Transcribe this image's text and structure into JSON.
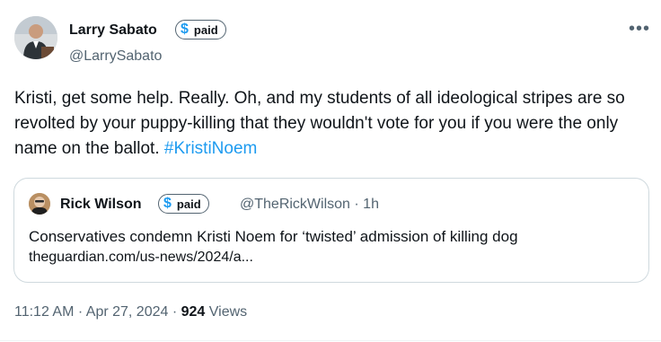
{
  "tweet": {
    "author_name": "Larry Sabato",
    "author_badge": "paid",
    "author_handle": "@LarrySabato",
    "more_icon": "more-options-icon",
    "text_main": "Kristi, get some help. Really. Oh, and my students of all ideological stripes are so revolted by your puppy-killing that they wouldn't vote for you if you were the only name on the ballot. ",
    "hashtag": "#KristiNoem",
    "timestamp": "11:12 AM",
    "separator": "·",
    "date": "Apr 27, 2024",
    "views_count": "924",
    "views_label": "Views"
  },
  "quote": {
    "author_name": "Rick Wilson",
    "author_badge": "paid",
    "author_handle": "@TheRickWilson",
    "separator": "·",
    "time_ago": "1h",
    "headline": "Conservatives condemn Kristi Noem for ‘twisted’ admission of killing dog",
    "link": "theguardian.com/us-news/2024/a..."
  },
  "colors": {
    "accent": "#1d9bf0",
    "text": "#0f1419",
    "muted": "#536471",
    "border": "#cfd9de"
  }
}
